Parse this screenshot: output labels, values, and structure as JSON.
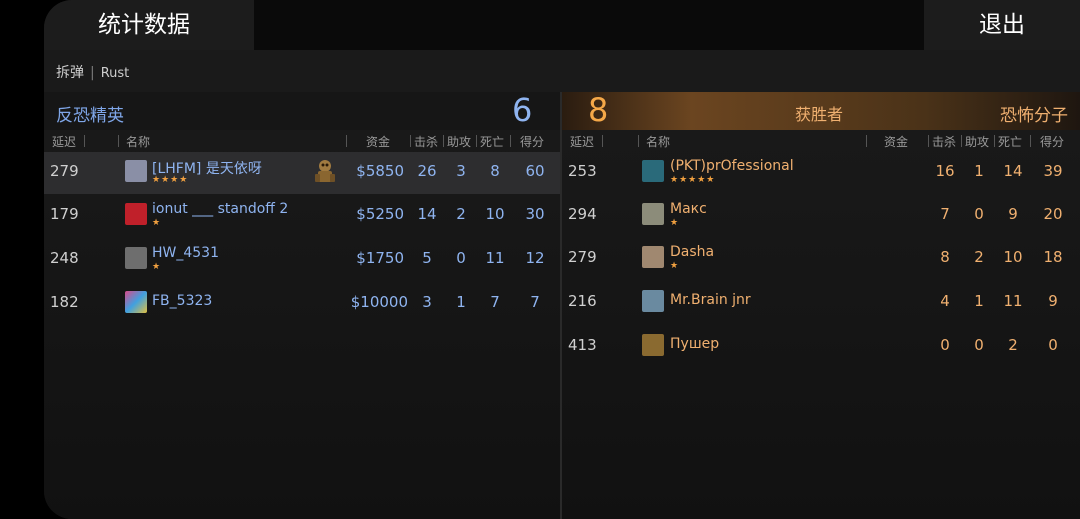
{
  "header": {
    "title": "统计数据",
    "exit_label": "退出"
  },
  "match": {
    "mode": "拆弹",
    "separator": "|",
    "map": "Rust"
  },
  "ct": {
    "name": "反恐精英",
    "score": "6",
    "columns": {
      "ping": "延迟",
      "name": "名称",
      "money": "资金",
      "kills": "击杀",
      "assists": "助攻",
      "deaths": "死亡",
      "score": "得分"
    },
    "players": [
      {
        "ping": "279",
        "name": "[LHFM] 是天依呀",
        "stars": "★★★★",
        "money": "$5850",
        "kills": "26",
        "assists": "3",
        "deaths": "8",
        "score": "60",
        "avatar_color": "#8a8fa6",
        "has_bomb": true,
        "highlighted": true
      },
      {
        "ping": "179",
        "name": "ionut ___ standoff 2",
        "stars": "★",
        "money": "$5250",
        "kills": "14",
        "assists": "2",
        "deaths": "10",
        "score": "30",
        "avatar_color": "#c0202a"
      },
      {
        "ping": "248",
        "name": "HW_4531",
        "stars": "★",
        "money": "$1750",
        "kills": "5",
        "assists": "0",
        "deaths": "11",
        "score": "12",
        "avatar_color": "#6e6e6e"
      },
      {
        "ping": "182",
        "name": "FB_5323",
        "stars": "",
        "money": "$10000",
        "kills": "3",
        "assists": "1",
        "deaths": "7",
        "score": "7",
        "avatar_color": "#d84a8a"
      }
    ]
  },
  "t": {
    "name": "恐怖分子",
    "score": "8",
    "winner_label": "获胜者",
    "columns": {
      "ping": "延迟",
      "name": "名称",
      "money": "资金",
      "kills": "击杀",
      "assists": "助攻",
      "deaths": "死亡",
      "score": "得分"
    },
    "players": [
      {
        "ping": "253",
        "name": "(PKT)prOfessional",
        "stars": "★★★★★",
        "kills": "16",
        "assists": "1",
        "deaths": "14",
        "score": "39",
        "avatar_color": "#2a6a7a"
      },
      {
        "ping": "294",
        "name": "Макс",
        "stars": "★",
        "kills": "7",
        "assists": "0",
        "deaths": "9",
        "score": "20",
        "avatar_color": "#8c8c7a"
      },
      {
        "ping": "279",
        "name": "Dasha",
        "stars": "★",
        "kills": "8",
        "assists": "2",
        "deaths": "10",
        "score": "18",
        "avatar_color": "#a08870"
      },
      {
        "ping": "216",
        "name": "Mr.Brain jnr",
        "stars": "",
        "kills": "4",
        "assists": "1",
        "deaths": "11",
        "score": "9",
        "avatar_color": "#6a8aa0"
      },
      {
        "ping": "413",
        "name": "Пушер",
        "stars": "",
        "kills": "0",
        "assists": "0",
        "deaths": "2",
        "score": "0",
        "avatar_color": "#8a6a30"
      }
    ]
  },
  "colors": {
    "ct_accent": "#8fb4f0",
    "t_accent": "#f0b070",
    "star": "#f0a040"
  }
}
